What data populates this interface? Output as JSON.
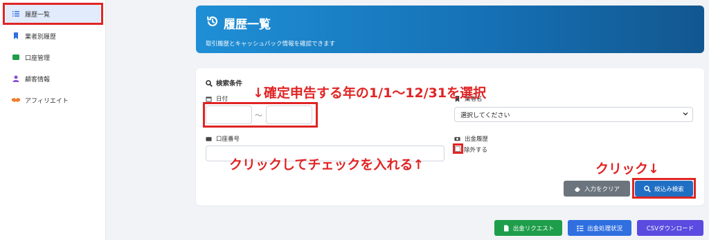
{
  "sidebar": {
    "items": [
      {
        "label": "履歴一覧",
        "icon": "list-icon"
      },
      {
        "label": "業者別履歴",
        "icon": "bookmark-icon"
      },
      {
        "label": "口座管理",
        "icon": "wallet-icon"
      },
      {
        "label": "顧客情報",
        "icon": "user-icon"
      },
      {
        "label": "アフィリエイト",
        "icon": "handshake-icon"
      }
    ]
  },
  "header": {
    "title": "履歴一覧",
    "subtitle": "取引履歴とキャッシュバック情報を確認できます",
    "icon": "history-icon"
  },
  "search": {
    "title": "検索条件",
    "date_label": "日付",
    "date_separator": "〜",
    "dealer_label": "業者名",
    "dealer_value": "選択してください",
    "account_label": "口座番号",
    "withdraw_label": "出金履歴",
    "exclude_label": "除外する",
    "clear_button": "入力をクリア",
    "search_button": "絞込み検索"
  },
  "footer_buttons": {
    "withdraw_request": "出金リクエスト",
    "withdraw_status": "出金処理状況",
    "csv_download": "CSVダウンロード"
  },
  "annotations": {
    "date_note": "↓確定申告する年の1/1〜12/31を選択",
    "check_note": "クリックしてチェックを入れる↑",
    "click_note": "クリック↓"
  },
  "colors": {
    "annotation_red": "#e02424",
    "banner_blue": "#156fb3",
    "search_button": "#1f6fc4",
    "clear_button": "#6c757d",
    "green_button": "#1e9e4a",
    "blue_button": "#2f6fe0",
    "purple_button": "#5b4be0"
  }
}
